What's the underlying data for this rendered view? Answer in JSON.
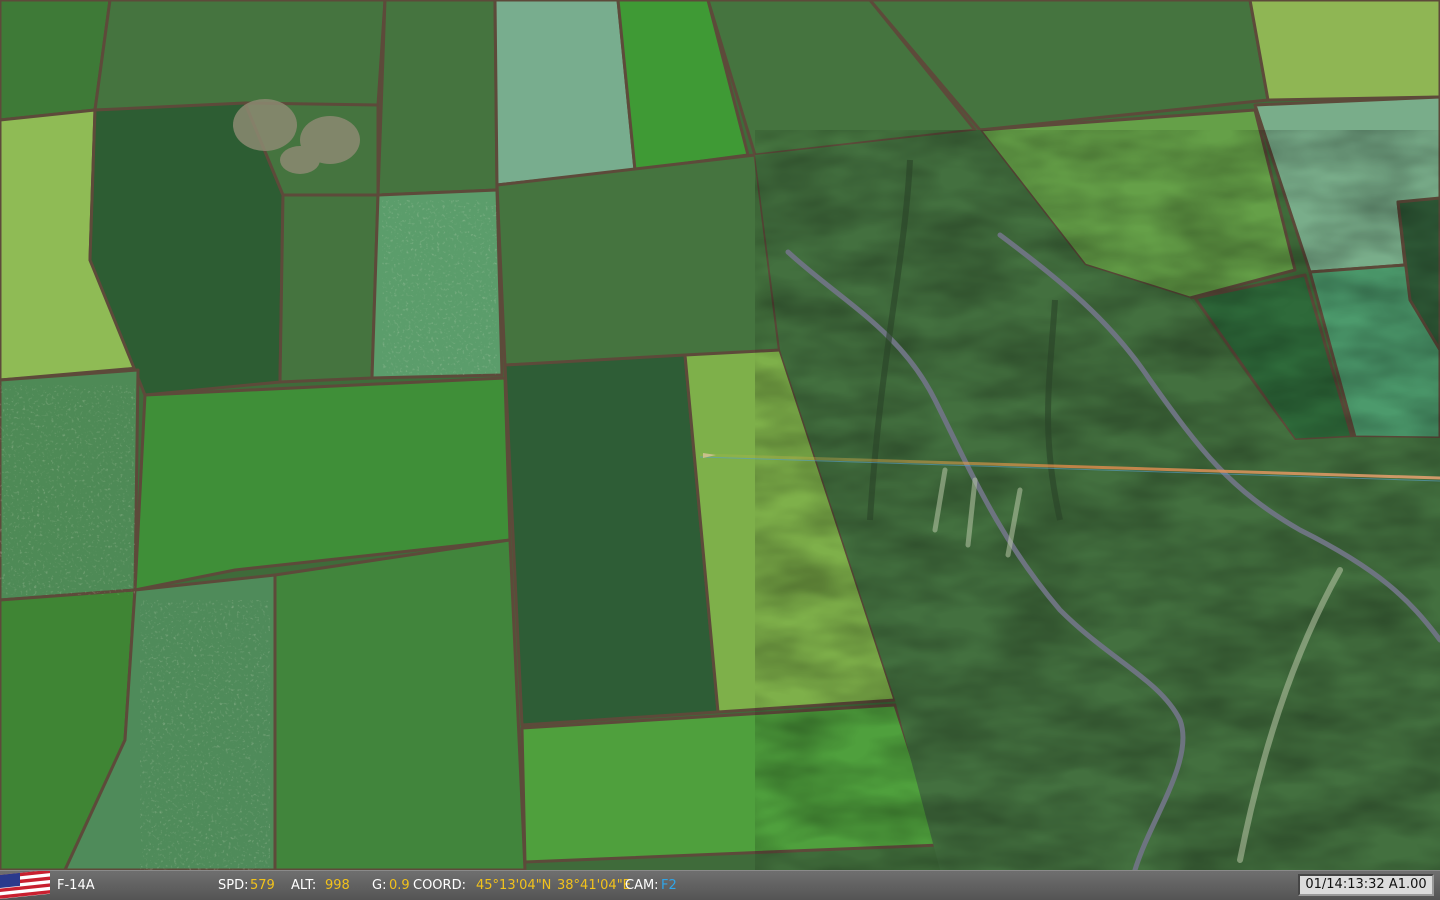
{
  "scene": {
    "name": "farmland-aerial-view",
    "colors": {
      "dark_field": "#2f5a30",
      "mid_field": "#3e7a37",
      "bright_field": "#58982f",
      "pale_field": "#8db25a",
      "teal_field": "#5f9a74",
      "scrub": "#43703f",
      "road": "#6d7480",
      "hedge": "#5d4a3a"
    }
  },
  "hud": {
    "aircraft": "F-14A",
    "speed_label": "SPD:",
    "speed_value": "579",
    "altitude_label": "ALT:",
    "altitude_value": "998",
    "g_label": "G:",
    "g_value": "0.9",
    "coord_label": "COORD:",
    "latitude": "45°13'04\"N",
    "longitude": "38°41'04\"E",
    "cam_label": "CAM:",
    "cam_value": "F2",
    "time": "01/14:13:32 A1.00"
  }
}
